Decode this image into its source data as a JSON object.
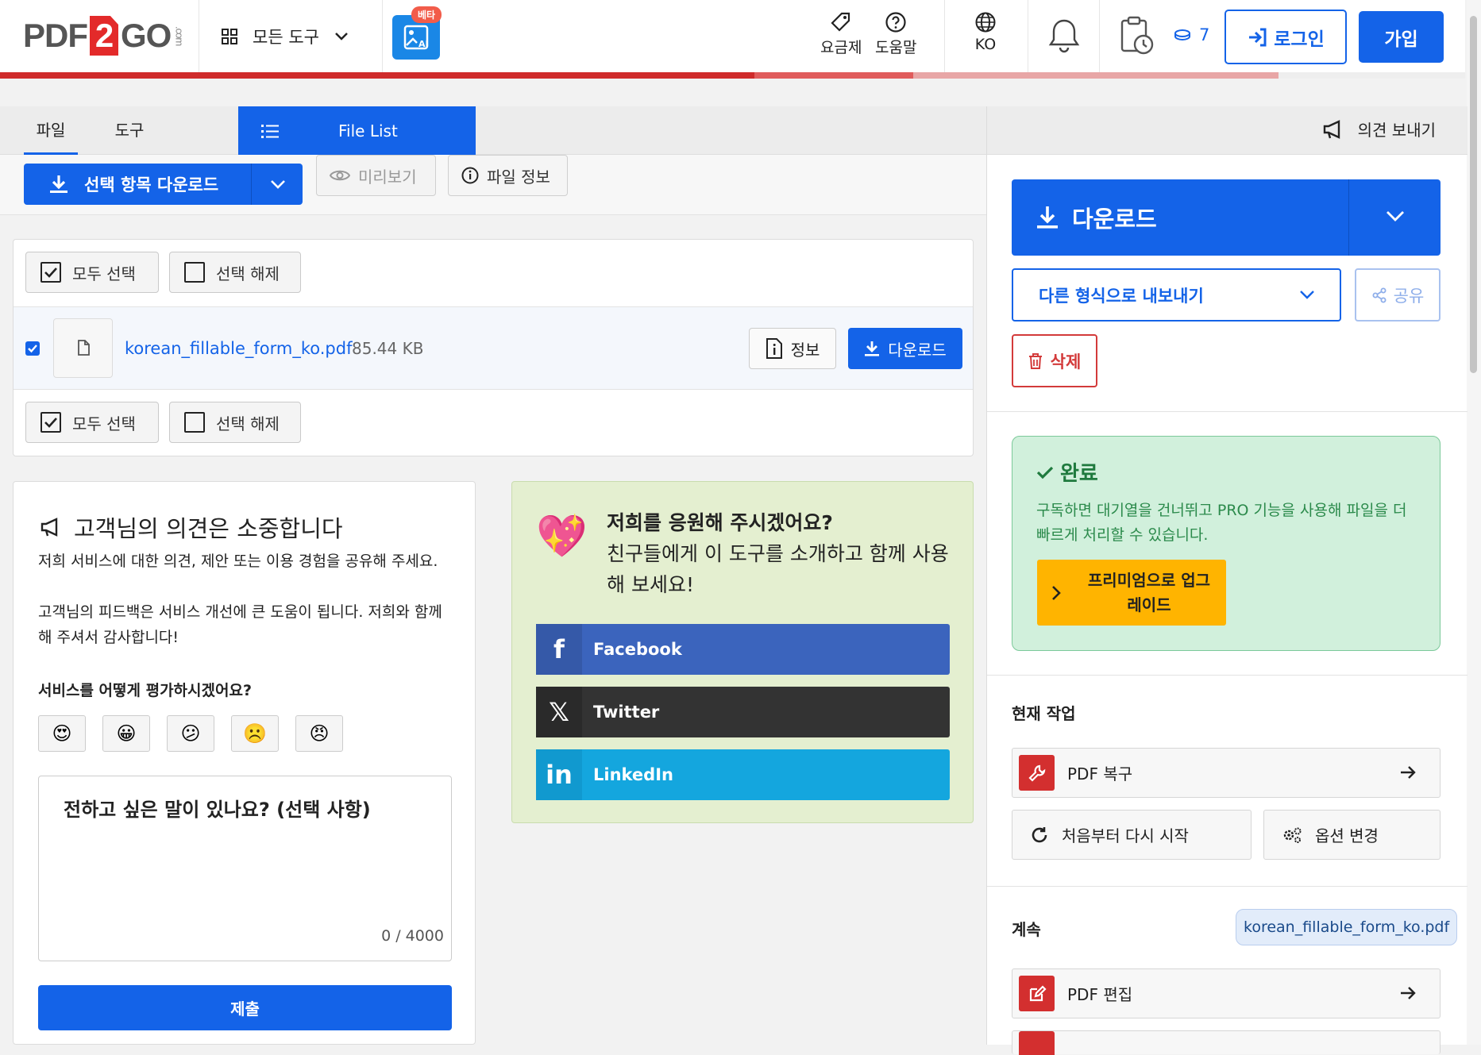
{
  "header": {
    "logo": {
      "left": "PDF",
      "num": "2",
      "right": "GO",
      "suffix": ".com"
    },
    "all_tools": "모든 도구",
    "beta_badge": "베타",
    "pricing": "요금제",
    "help": "도움말",
    "language": "KO",
    "credits": "7",
    "login": "로그인",
    "signup": "가입",
    "progress_colors": [
      "#cf2b2b",
      "#e05c5c",
      "#e8a6a6",
      "#eeeeee"
    ]
  },
  "tabs": {
    "file": "파일",
    "tools": "도구",
    "file_list": "File List"
  },
  "toolbar": {
    "download_selected": "선택 항목 다운로드",
    "preview": "미리보기",
    "file_info": "파일 정보"
  },
  "file_box": {
    "select_all": "모두 선택",
    "deselect": "선택 해제",
    "files": [
      {
        "name": "korean_fillable_form_ko.pdf",
        "size": "85.44 KB"
      }
    ],
    "info": "정보",
    "download": "다운로드"
  },
  "feedback": {
    "title": "고객님의 의견은 소중합니다",
    "p1": "저희 서비스에 대한 의견, 제안 또는 이용 경험을 공유해 주세요.",
    "p2": "고객님의 피드백은 서비스 개선에 큰 도움이 됩니다. 저희와 함께해 주셔서 감사합니다!",
    "rating_question": "서비스를 어떻게 평가하시겠어요?",
    "emojis": [
      "😍",
      "😀",
      "😕",
      "☹️",
      "😠"
    ],
    "textarea_placeholder": "전하고 싶은 말이 있나요? (선택 사항)",
    "char_count": "0 / 4000",
    "submit": "제출"
  },
  "support": {
    "title": "저희를 응원해 주시겠어요?",
    "body": "친구들에게 이 도구를 소개하고 함께 사용해 보세요!",
    "heart": "💖",
    "facebook": "Facebook",
    "twitter": "Twitter",
    "linkedin": "LinkedIn",
    "colors": {
      "facebook": "#3b64bd",
      "twitter": "#333333",
      "linkedin": "#14a6de"
    }
  },
  "right": {
    "feedback": "의견 보내기",
    "download": "다운로드",
    "export": "다른 형식으로 내보내기",
    "share": "공유",
    "delete": "삭제",
    "done_title": "완료",
    "done_text": "구독하면 대기열을 건너뛰고 PRO 기능을 사용해 파일을 더 빠르게 처리할 수 있습니다.",
    "premium": "프리미엄으로 업그레이드",
    "current_task": "현재 작업",
    "repair": "PDF 복구",
    "restart": "처음부터 다시 시작",
    "change_options": "옵션 변경",
    "continue": "계속",
    "chip_file": "korean_fillable_form_ko.pdf",
    "edit": "PDF 편집"
  }
}
